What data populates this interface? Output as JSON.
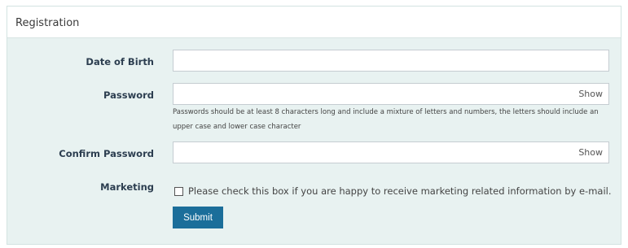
{
  "form": {
    "title": "Registration",
    "fields": {
      "dob_label": "Date of Birth",
      "dob_value": "",
      "password_label": "Password",
      "password_value": "",
      "password_show": "Show",
      "password_help": "Passwords should be at least 8 characters long and include a mixture of letters and numbers, the letters should include an upper case and lower case character",
      "confirm_label": "Confirm Password",
      "confirm_value": "",
      "confirm_show": "Show",
      "marketing_label": "Marketing",
      "marketing_checkbox_text": "Please check this box if you are happy to receive marketing related information by e-mail.",
      "marketing_checked": false
    },
    "submit_label": "Submit",
    "colors": {
      "panel_bg": "#e8f2f1",
      "header_bg": "#ffffff",
      "submit_bg": "#1b6e9a"
    }
  }
}
